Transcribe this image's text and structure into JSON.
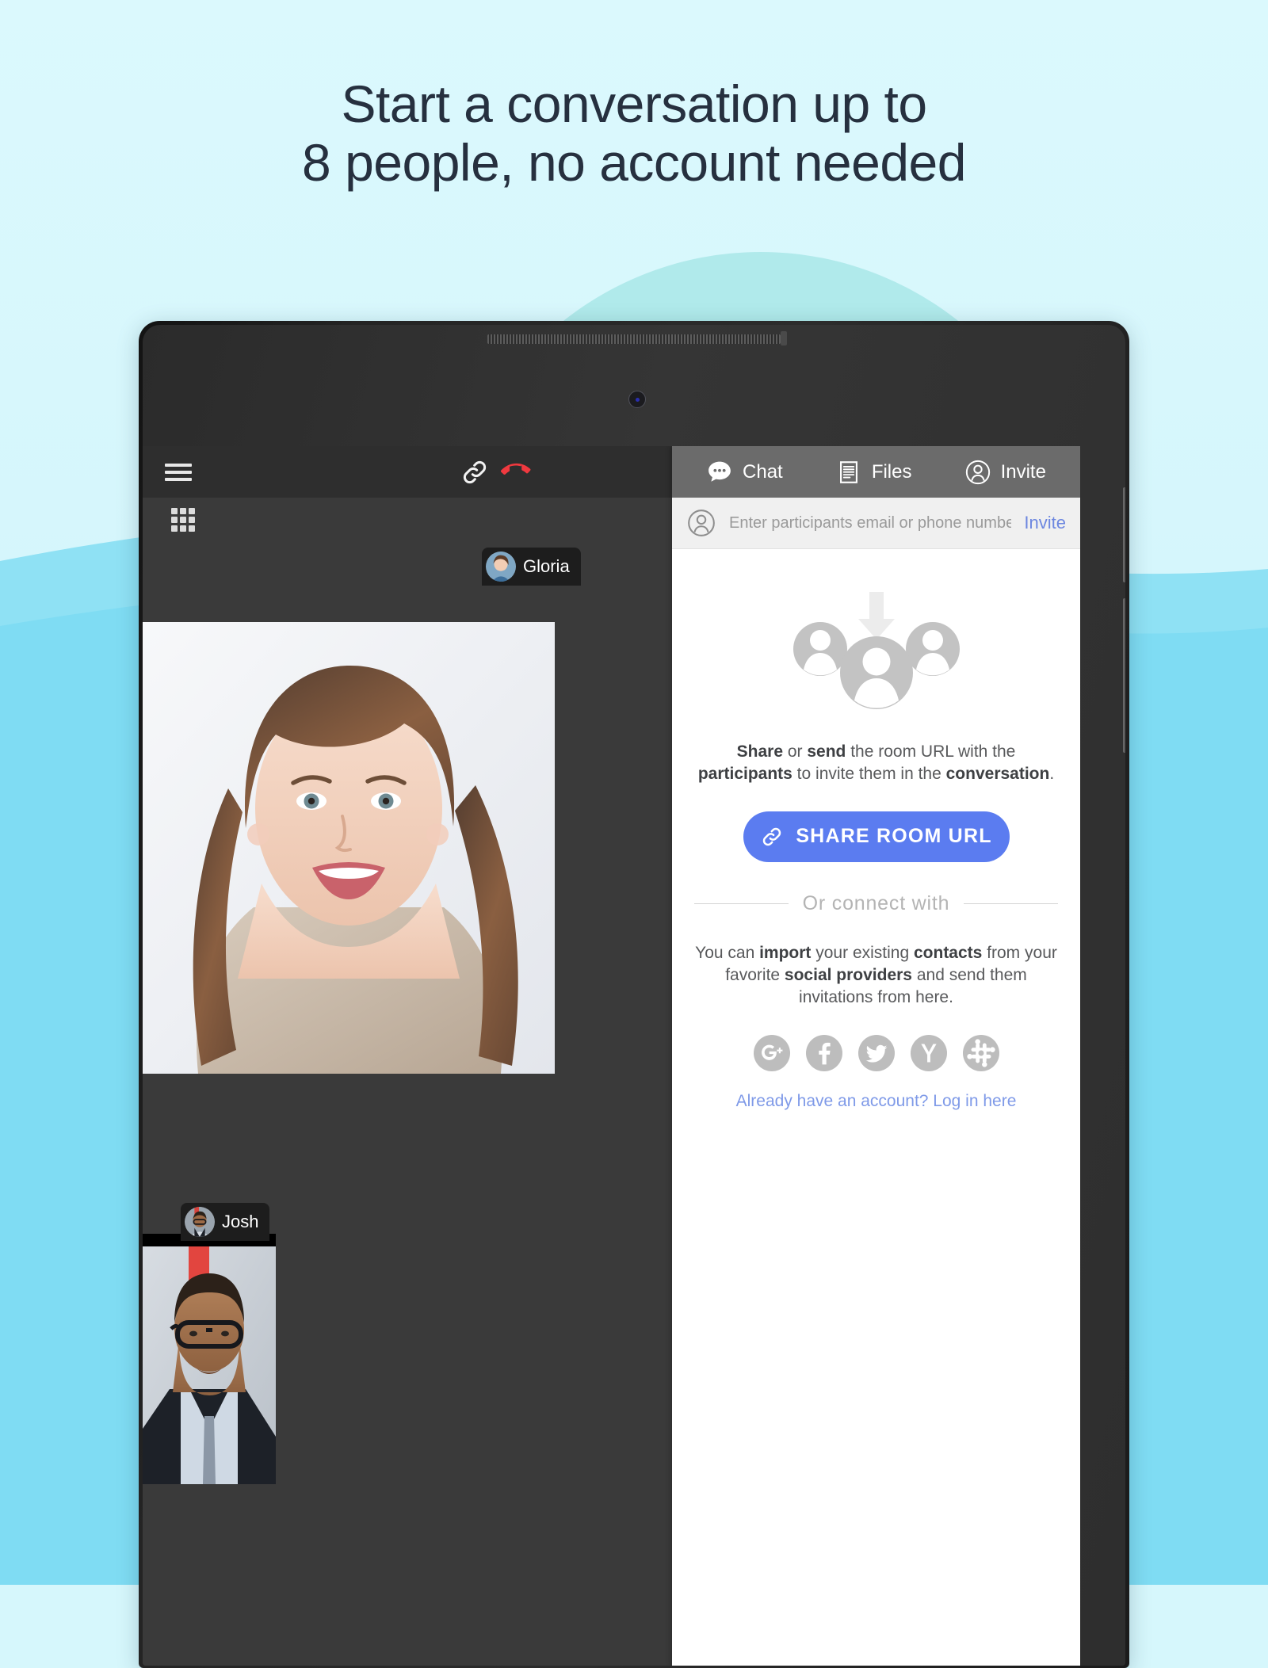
{
  "page": {
    "headline_line1": "Start a conversation up to",
    "headline_line2": "8 people, no account needed",
    "bg_top_color": "#dbf9fd",
    "bg_wave_color": "#7fdcf3",
    "bg_circle_color": "#a9e7e8"
  },
  "call_toolbar": {
    "menu_icon": "hamburger-menu-icon",
    "link_icon": "link-chain-icon",
    "hangup_icon": "hangup-phone-icon",
    "grid_icon": "grid-layout-icon"
  },
  "participants": [
    {
      "name": "Gloria",
      "avatar_icon": "avatar-gloria"
    },
    {
      "name": "Josh",
      "avatar_icon": "avatar-josh"
    }
  ],
  "panel": {
    "tabs": [
      {
        "label": "Chat",
        "icon": "chat-bubble-icon",
        "active": false
      },
      {
        "label": "Files",
        "icon": "files-document-icon",
        "active": false
      },
      {
        "label": "Invite",
        "icon": "person-circle-icon",
        "active": true
      }
    ],
    "invite_row": {
      "avatar_icon": "person-circle-icon",
      "input_value": "",
      "input_placeholder": "Enter participants email or phone number",
      "invite_label": "Invite"
    },
    "hero_icon": "import-contacts-illustration",
    "share_copy": {
      "part1": "Share",
      "part2": " or ",
      "part3": "send",
      "part4": " the room URL with the ",
      "part5": "participants",
      "part6": " to invite them in the ",
      "part7": "conversation",
      "part8": "."
    },
    "share_button": {
      "label": "SHARE ROOM URL",
      "icon": "link-chain-icon",
      "color": "#5b7cf0"
    },
    "divider_label": "Or connect with",
    "connect_copy": {
      "part1": "You can ",
      "part2": "import",
      "part3": " your existing ",
      "part4": "contacts",
      "part5": " from your favorite ",
      "part6": "social providers",
      "part7": " and send them invitations from here."
    },
    "social_providers": [
      {
        "name": "google-plus",
        "icon": "google-plus-icon"
      },
      {
        "name": "facebook",
        "icon": "facebook-icon"
      },
      {
        "name": "twitter",
        "icon": "twitter-icon"
      },
      {
        "name": "yandex",
        "icon": "yandex-icon"
      },
      {
        "name": "slack",
        "icon": "slack-hash-icon"
      }
    ],
    "login_link": "Already have an account? Log in here"
  }
}
